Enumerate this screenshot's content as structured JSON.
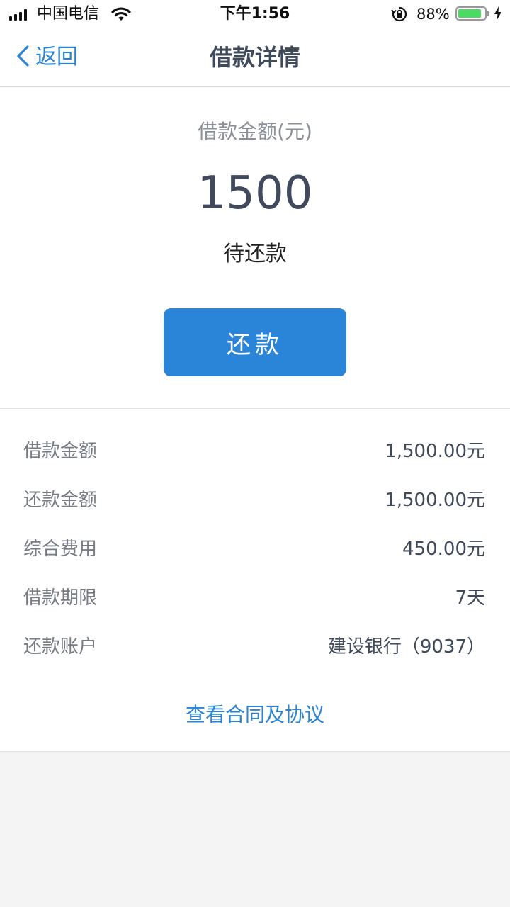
{
  "status_bar": {
    "carrier": "中国电信",
    "time": "下午1:56",
    "battery": "88%",
    "battery_level": 0.88
  },
  "nav": {
    "back_label": "返回",
    "title": "借款详情"
  },
  "summary": {
    "amount_label": "借款金额(元)",
    "amount": "1500",
    "status": "待还款",
    "repay_button": "还款"
  },
  "details": [
    {
      "label": "借款金额",
      "value": "1,500.00元"
    },
    {
      "label": "还款金额",
      "value": "1,500.00元"
    },
    {
      "label": "综合费用",
      "value": "450.00元"
    },
    {
      "label": "借款期限",
      "value": "7天"
    },
    {
      "label": "还款账户",
      "value": "建设银行（9037）"
    }
  ],
  "contract_link": "查看合同及协议",
  "colors": {
    "accent": "#2a84d8",
    "battery": "#4cd964",
    "background": "#f4f4f5"
  }
}
